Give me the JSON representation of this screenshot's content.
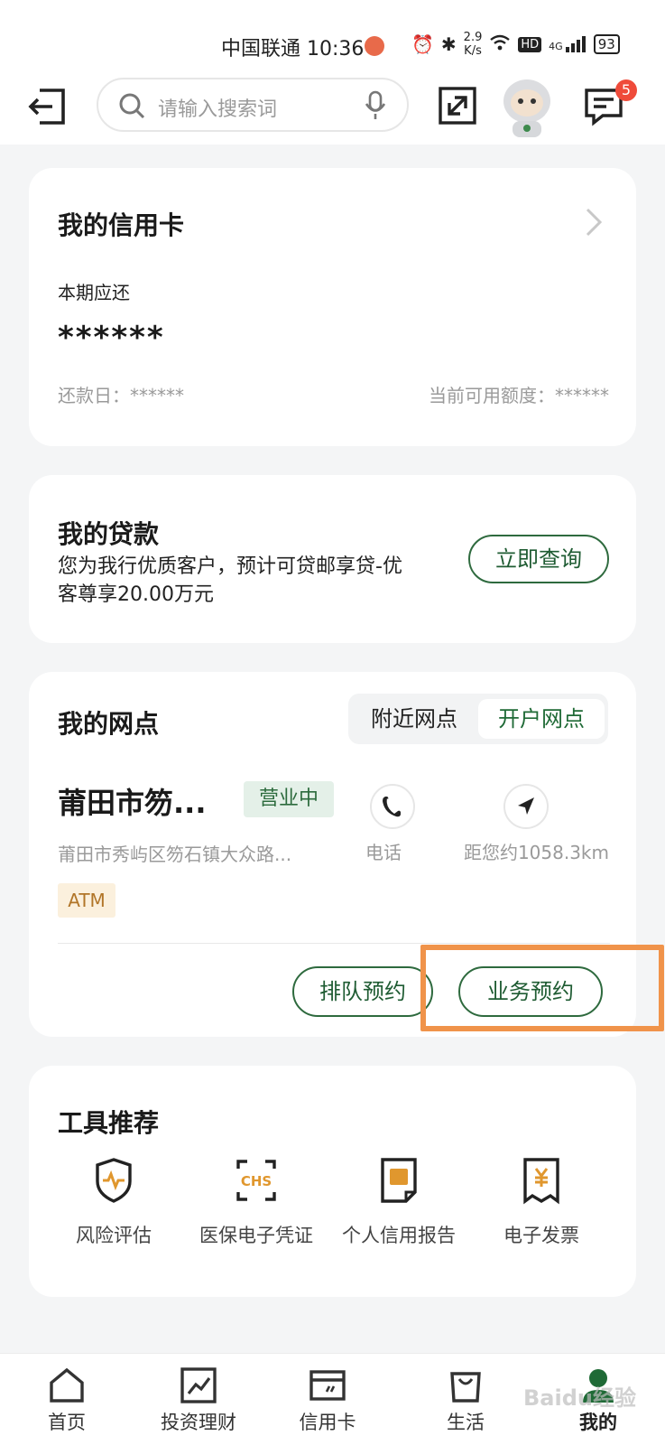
{
  "status_bar": {
    "carrier_time": "中国联通 10:36",
    "speed_value": "2.9",
    "speed_unit": "K/s",
    "hd": "HD",
    "net": "4G",
    "battery": "93"
  },
  "header": {
    "search_placeholder": "请输入搜索词",
    "message_badge": "5"
  },
  "credit_card": {
    "title": "我的信用卡",
    "due_label": "本期应还",
    "due_amount": "******",
    "repay_date": "还款日：******",
    "available_limit": "当前可用额度：******"
  },
  "loan": {
    "title": "我的贷款",
    "description": "您为我行优质客户，预计可贷邮享贷-优客尊享20.00万元",
    "query_button": "立即查询"
  },
  "branch": {
    "title": "我的网点",
    "tabs": [
      "附近网点",
      "开户网点"
    ],
    "active_tab": "开户网点",
    "name": "莆田市笏...",
    "status": "营业中",
    "address": "莆田市秀屿区笏石镇大众路...",
    "tag": "ATM",
    "phone_label": "电话",
    "distance": "距您约1058.3km",
    "queue_button": "排队预约",
    "business_button": "业务预约"
  },
  "tools": {
    "title": "工具推荐",
    "items": [
      {
        "label": "风险评估",
        "icon": "shield-pulse-icon"
      },
      {
        "label": "医保电子凭证",
        "icon": "chs-scan-icon"
      },
      {
        "label": "个人信用报告",
        "icon": "credit-report-icon"
      },
      {
        "label": "电子发票",
        "icon": "invoice-icon"
      }
    ]
  },
  "bottom_nav": {
    "items": [
      "首页",
      "投资理财",
      "信用卡",
      "生活",
      "我的"
    ],
    "active": "我的"
  },
  "watermark": "Baidu经验",
  "colors": {
    "accent_green": "#1f5c33",
    "highlight_orange": "#f0934a",
    "badge_red": "#ef4b3a"
  }
}
